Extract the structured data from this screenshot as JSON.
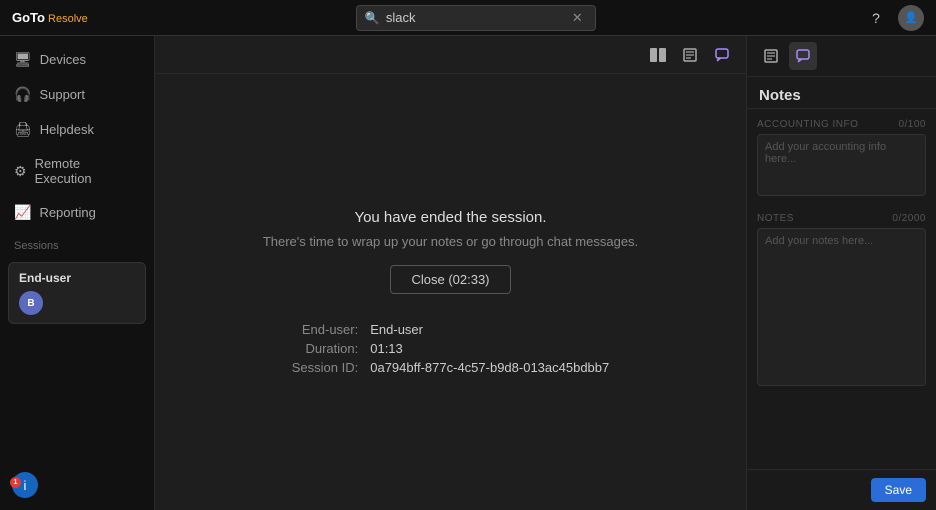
{
  "topbar": {
    "logo_goto": "GoTo",
    "logo_resolve": "Resolve",
    "search_placeholder": "slack",
    "search_value": "slack"
  },
  "sidebar": {
    "nav_items": [
      {
        "id": "devices",
        "label": "Devices",
        "icon": "🖥"
      },
      {
        "id": "support",
        "label": "Support",
        "icon": "🎧"
      },
      {
        "id": "helpdesk",
        "label": "Helpdesk",
        "icon": "🖨"
      },
      {
        "id": "remote-execution",
        "label": "Remote Execution",
        "icon": "⚙"
      },
      {
        "id": "reporting",
        "label": "Reporting",
        "icon": "📈"
      }
    ],
    "sessions_label": "Sessions",
    "session_card": {
      "title": "End-user",
      "avatar_initials": "B"
    },
    "info_badge": "i",
    "info_badge_count": "1"
  },
  "center": {
    "session_ended_title": "You have ended the session.",
    "session_ended_sub": "There's time to wrap up your notes or go through chat messages.",
    "close_button": "Close (02:33)",
    "details": {
      "end_user_label": "End-user:",
      "end_user_value": "End-user",
      "duration_label": "Duration:",
      "duration_value": "01:13",
      "session_id_label": "Session ID:",
      "session_id_value": "0a794bff-877c-4c57-b9d8-013ac45bdbb7"
    }
  },
  "notes_panel": {
    "title": "Notes",
    "accounting_info_label": "ACCOUNTING INFO",
    "accounting_info_count": "0/100",
    "accounting_info_placeholder": "Add your accounting info here...",
    "notes_label": "NOTES",
    "notes_count": "0/2000",
    "notes_placeholder": "Add your notes here...",
    "save_button": "Save"
  }
}
